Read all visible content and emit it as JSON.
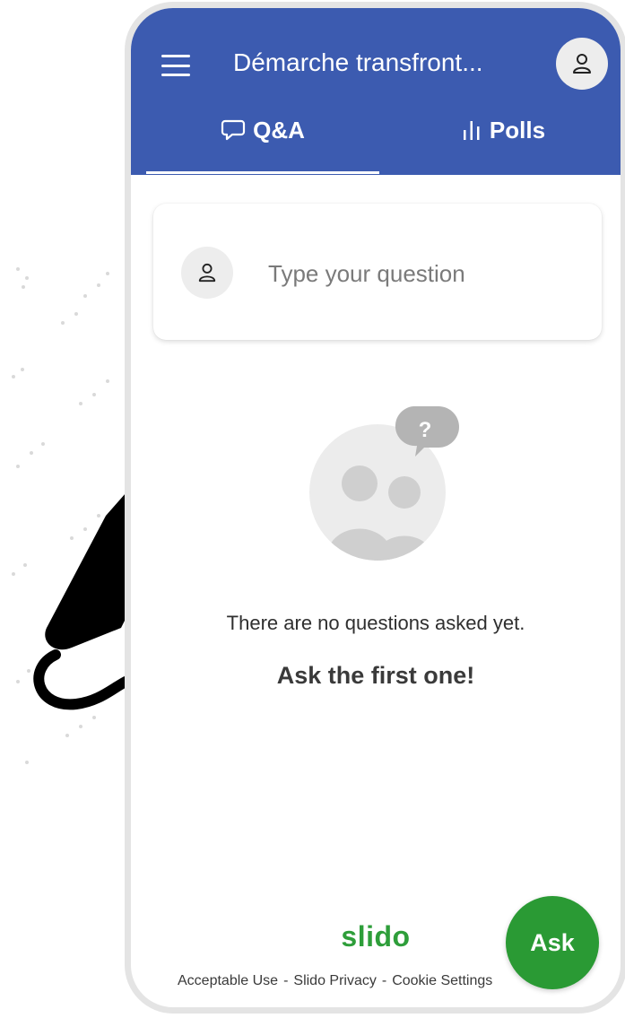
{
  "header": {
    "event_title": "Démarche transfront...",
    "menu_icon": "hamburger-menu-icon",
    "avatar_icon": "user-icon",
    "background_color": "#3c5bb0"
  },
  "tabs": [
    {
      "label": "Q&A",
      "icon": "speech-bubble-icon",
      "active": true
    },
    {
      "label": "Polls",
      "icon": "bar-chart-icon",
      "active": false
    }
  ],
  "question_box": {
    "placeholder": "Type your question",
    "avatar_icon": "user-icon"
  },
  "empty_state": {
    "illustration_icon": "people-question-icon",
    "line1": "There are no questions asked yet.",
    "line2": "Ask the first one!"
  },
  "footer": {
    "brand": "slido",
    "links": [
      "Acceptable Use",
      "Slido Privacy",
      "Cookie Settings"
    ],
    "separator": "-",
    "brand_color": "#2e9e3a"
  },
  "ask_button": {
    "label": "Ask",
    "color": "#2a9a34"
  }
}
